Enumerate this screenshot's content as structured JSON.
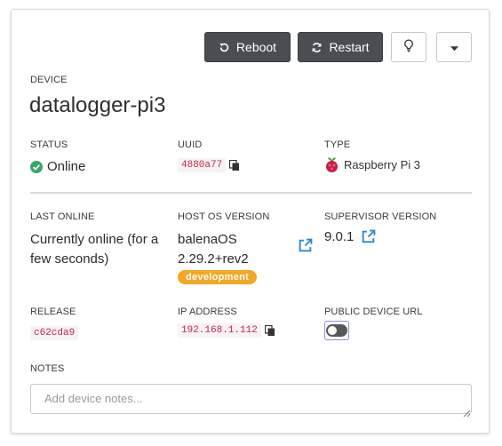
{
  "toolbar": {
    "reboot_label": "Reboot",
    "restart_label": "Restart"
  },
  "device": {
    "section_label": "DEVICE",
    "name": "datalogger-pi3"
  },
  "status": {
    "label": "STATUS",
    "value": "Online",
    "color": "#3aa56a"
  },
  "uuid": {
    "label": "UUID",
    "value": "4880a77"
  },
  "type": {
    "label": "TYPE",
    "value": "Raspberry Pi 3"
  },
  "last_online": {
    "label": "LAST ONLINE",
    "line1": "Currently online (for a",
    "line2": "few seconds)"
  },
  "host_os": {
    "label": "HOST OS VERSION",
    "line1": "balenaOS",
    "line2": "2.29.2+rev2",
    "badge": "development"
  },
  "supervisor": {
    "label": "SUPERVISOR VERSION",
    "value": "9.0.1"
  },
  "release": {
    "label": "RELEASE",
    "value": "c62cda9"
  },
  "ip": {
    "label": "IP ADDRESS",
    "value": "192.168.1.112"
  },
  "public_url": {
    "label": "PUBLIC DEVICE URL",
    "enabled": false
  },
  "notes": {
    "label": "NOTES",
    "placeholder": "Add device notes...",
    "value": ""
  },
  "colors": {
    "dark_button": "#4a4d52",
    "link_blue": "#2a8bd6",
    "badge_orange": "#f5a623",
    "code_red": "#c7254e"
  },
  "icons": [
    "reboot-icon",
    "restart-icon",
    "lightbulb-icon",
    "caret-down-icon",
    "check-circle-icon",
    "copy-icon",
    "raspberry-pi-icon",
    "external-link-icon"
  ]
}
